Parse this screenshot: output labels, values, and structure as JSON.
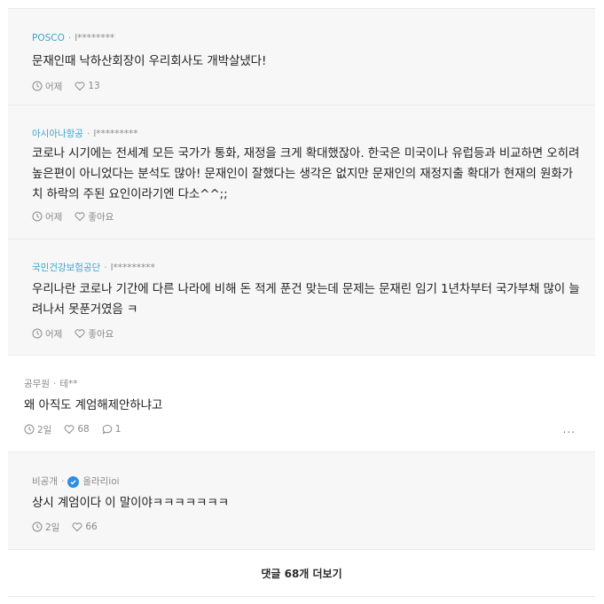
{
  "comments": [
    {
      "company": "POSCO",
      "nick": "l********",
      "text": "문재인때 낙하산회장이 우리회사도 개박살냈다!",
      "time": "어제",
      "likes": "13"
    },
    {
      "company": "아시아나항공",
      "nick": "l*********",
      "text": "코로나 시기에는 전세계 모든 국가가 통화, 재정을 크게 확대했잖아. 한국은 미국이나 유럽등과 비교하면 오히려 높은편이 아니었다는 분석도 많아! 문재인이 잘했다는 생각은 없지만 문재인의 재정지출 확대가 현재의 원화가치 하락의 주된 요인이라기엔 다소^^;;",
      "time": "어제",
      "likes": "좋아요"
    },
    {
      "company": "국민건강보험공단",
      "nick": "l*********",
      "text": "우리나란 코로나 기간에 다른 나라에 비해 돈 적게 푼건 맞는데 문제는 문재린 임기 1년차부터 국가부채 많이 늘려나서 못푼거였음 ㅋ",
      "time": "어제",
      "likes": "좋아요"
    },
    {
      "company": "공무원",
      "nick": "테**",
      "text": "왜 아직도 계엄해제안하냐고",
      "time": "2일",
      "likes": "68",
      "replies": "1",
      "more": "..."
    },
    {
      "company": "비공개",
      "nick": "올라리ioi",
      "text": "상시 계엄이다 이 말이야ㅋㅋㅋㅋㅋㅋㅋ",
      "time": "2일",
      "likes": "66"
    }
  ],
  "load_more_label": "댓글 68개 더보기"
}
